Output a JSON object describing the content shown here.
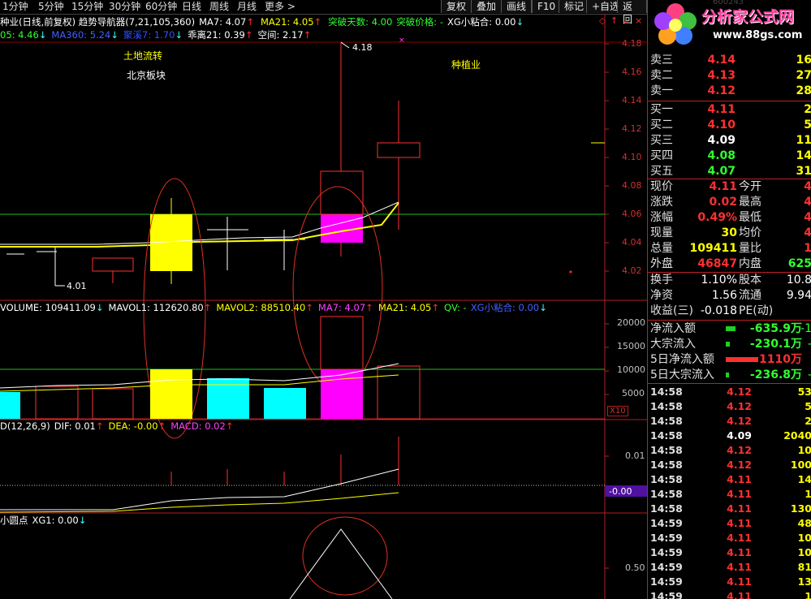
{
  "toolbar": {
    "periods": [
      "1分钟",
      "5分钟",
      "15分钟",
      "30分钟",
      "60分钟",
      "日线",
      "周线",
      "月线",
      "更多 >"
    ],
    "buttons": [
      "复权",
      "叠加",
      "画线",
      "F10",
      "标记",
      "+自选",
      "返回"
    ]
  },
  "info1": {
    "name": "种业(日线,前复权) 趋势导航器(7,21,105,360)",
    "ma7": "MA7: 4.07",
    "ma21": "MA21: 4.05",
    "tupo_days": "突破天数: 4.00",
    "tupo_price": "突破价格: -",
    "xg": "XG小粘合: 0.00"
  },
  "info2": {
    "a": "05: 4.46",
    "ma360": "MA360: 5.24",
    "c": "聚溪7: 1.70",
    "d": "乖离21: 0.39",
    "e": "空间: 2.17"
  },
  "annotations": {
    "land": "土地流转",
    "beijing": "北京板块",
    "planting": "种植业",
    "high": "4.18",
    "low": "4.01"
  },
  "price_axis": [
    "4.18",
    "4.16",
    "4.14",
    "4.12",
    "4.10",
    "4.08",
    "4.06",
    "4.04",
    "4.02"
  ],
  "volume_info": {
    "vol": "VOLUME: 109411.09",
    "mavol1": "MAVOL1: 112620.80",
    "mavol2": "MAVOL2: 88510.40",
    "ma7": "MA7: 4.07",
    "ma21": "MA21: 4.05",
    "qv": "QV: -",
    "xg": "XG小粘合: 0.00"
  },
  "volume_axis": [
    "20000",
    "15000",
    "10000",
    "5000"
  ],
  "volume_unit": "X10",
  "macd_info": {
    "name": "D(12,26,9)",
    "dif": "DIF: 0.01",
    "dea": "DEA: -0.00",
    "macd": "MACD: 0.02"
  },
  "macd_axis": {
    "top": "0.01",
    "cur": "-0.00"
  },
  "dot_info": {
    "name": "小圆点",
    "xg1": "XG1: 0.00"
  },
  "dot_axis": "0.50",
  "logo": {
    "text": "分析家公式网",
    "url": "www.88gs.com",
    "faded": "600243"
  },
  "orderbook": [
    {
      "label": "卖三",
      "price": "4.14",
      "vol": "16"
    },
    {
      "label": "卖二",
      "price": "4.13",
      "vol": "27"
    },
    {
      "label": "卖一",
      "price": "4.12",
      "vol": "28"
    },
    {
      "label": "买一",
      "price": "4.11",
      "vol": "2"
    },
    {
      "label": "买二",
      "price": "4.10",
      "vol": "5"
    },
    {
      "label": "买三",
      "price": "4.09",
      "vol": "11"
    },
    {
      "label": "买四",
      "price": "4.08",
      "vol": "14"
    },
    {
      "label": "买五",
      "price": "4.07",
      "vol": "31"
    }
  ],
  "stats": [
    {
      "l1": "现价",
      "v1": "4.11",
      "l2": "今开",
      "v2": "4"
    },
    {
      "l1": "涨跌",
      "v1": "0.02",
      "l2": "最高",
      "v2": "4"
    },
    {
      "l1": "涨幅",
      "v1": "0.49%",
      "l2": "最低",
      "v2": "4"
    },
    {
      "l1": "现量",
      "v1": "30",
      "l2": "均价",
      "v2": "4"
    },
    {
      "l1": "总量",
      "v1": "109411",
      "l2": "量比",
      "v2": "1"
    },
    {
      "l1": "外盘",
      "v1": "46847",
      "l2": "内盘",
      "v2": "625"
    }
  ],
  "stats2": [
    {
      "l1": "换手",
      "v1": "1.10%",
      "l2": "股本",
      "v2": "10.8"
    },
    {
      "l1": "净资",
      "v1": "1.56",
      "l2": "流通",
      "v2": "9.94"
    },
    {
      "l1": "收益(三)",
      "v1": "-0.018",
      "l2": "PE(动)",
      "v2": ""
    }
  ],
  "flows": [
    {
      "label": "净流入额",
      "value": "-635.9万",
      "extra": "-1"
    },
    {
      "label": "大宗流入",
      "value": "-230.1万",
      "extra": "-"
    },
    {
      "label": "5日净流入额",
      "value": "1110万",
      "extra": ""
    },
    {
      "label": "5日大宗流入",
      "value": "-236.8万",
      "extra": "-"
    }
  ],
  "ticks": [
    {
      "t": "14:58",
      "p": "4.12",
      "n": "53"
    },
    {
      "t": "14:58",
      "p": "4.12",
      "n": "5"
    },
    {
      "t": "14:58",
      "p": "4.12",
      "n": "2"
    },
    {
      "t": "14:58",
      "p": "4.09",
      "n": "2040"
    },
    {
      "t": "14:58",
      "p": "4.12",
      "n": "10"
    },
    {
      "t": "14:58",
      "p": "4.12",
      "n": "100"
    },
    {
      "t": "14:58",
      "p": "4.11",
      "n": "14"
    },
    {
      "t": "14:58",
      "p": "4.11",
      "n": "1"
    },
    {
      "t": "14:58",
      "p": "4.11",
      "n": "130"
    },
    {
      "t": "14:59",
      "p": "4.11",
      "n": "48"
    },
    {
      "t": "14:59",
      "p": "4.11",
      "n": "10"
    },
    {
      "t": "14:59",
      "p": "4.11",
      "n": "10"
    },
    {
      "t": "14:59",
      "p": "4.11",
      "n": "81"
    },
    {
      "t": "14:59",
      "p": "4.11",
      "n": "13"
    },
    {
      "t": "14:59",
      "p": "4.11",
      "n": "1"
    }
  ],
  "colors": {
    "up": "#ff3030",
    "down": "#30ff30",
    "bg": "#000000",
    "ma7": "#ffffff",
    "ma21": "#ffff00"
  }
}
